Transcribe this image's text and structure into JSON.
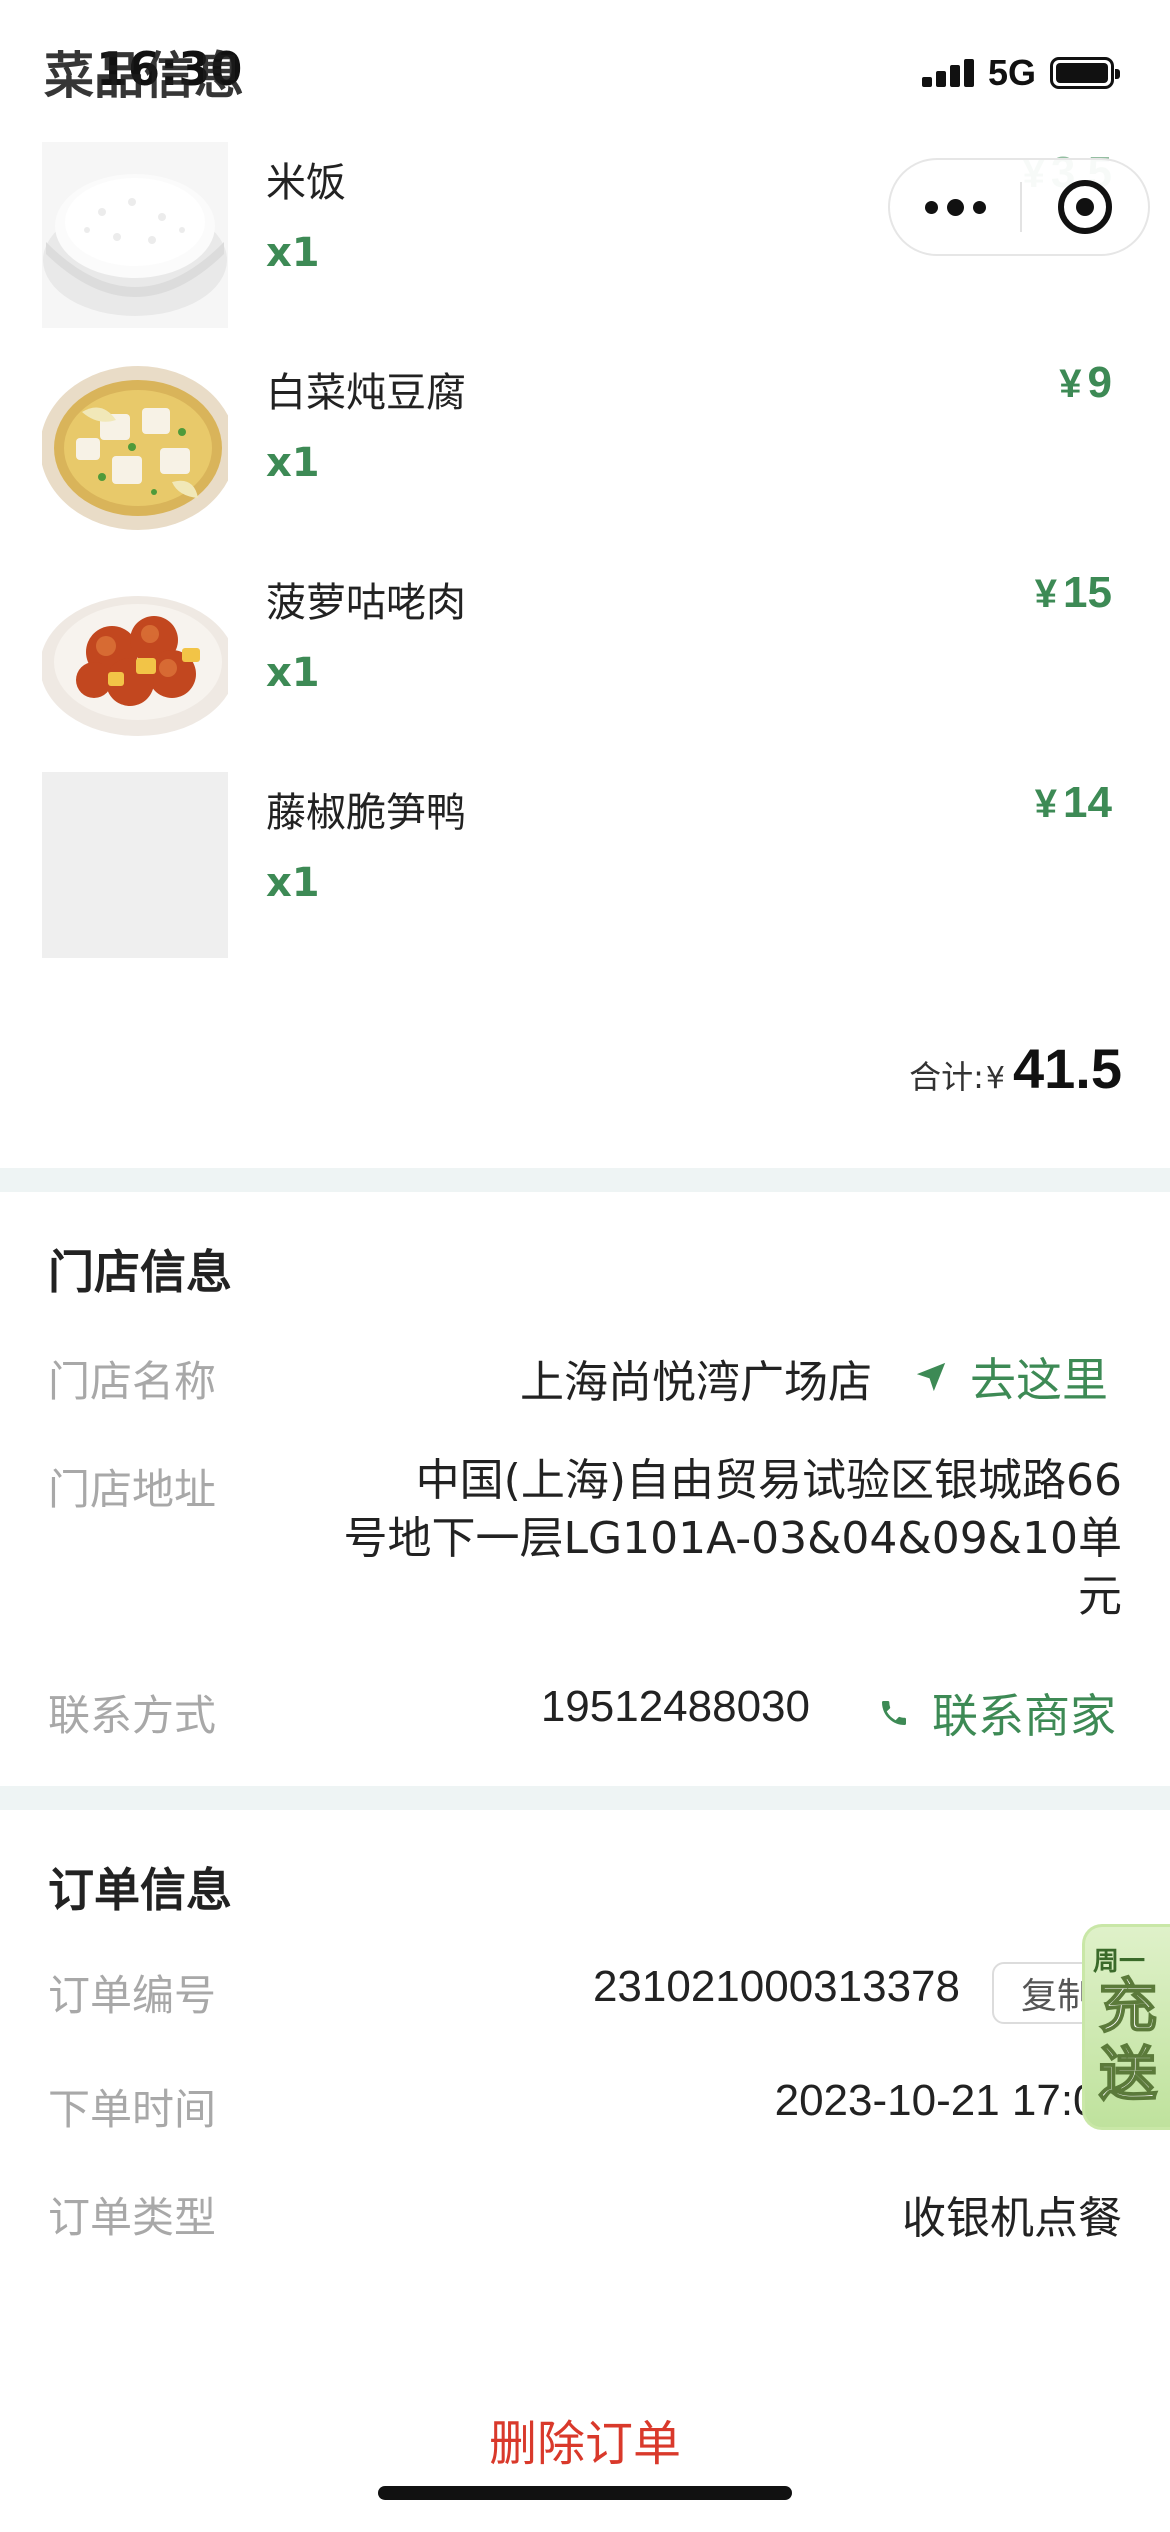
{
  "status_bar": {
    "time": "16:30",
    "network": "5G",
    "battery_percent": 100
  },
  "dishes_section": {
    "title": "菜品信息"
  },
  "dishes": [
    {
      "name": "米饭",
      "qty": "x1",
      "currency": "¥",
      "price": "3.5",
      "image": "rice-bowl"
    },
    {
      "name": "白菜炖豆腐",
      "qty": "x1",
      "currency": "¥",
      "price": "9",
      "image": "cabbage-tofu"
    },
    {
      "name": "菠萝咕咾肉",
      "qty": "x1",
      "currency": "¥",
      "price": "15",
      "image": "pineapple-pork"
    },
    {
      "name": "藤椒脆笋鸭",
      "qty": "x1",
      "currency": "¥",
      "price": "14",
      "image": "placeholder"
    }
  ],
  "total": {
    "label": "合计:",
    "currency": "¥",
    "value": "41.5"
  },
  "store": {
    "title": "门店信息",
    "name_label": "门店名称",
    "name_value": "上海尚悦湾广场店",
    "navigate_label": "去这里",
    "address_label": "门店地址",
    "address_line1": "中国(上海)自由贸易试验区银城路66",
    "address_line2": "号地下一层LG101A-03&04&09&10单",
    "address_line3": "元",
    "contact_label": "联系方式",
    "contact_value": "19512488030",
    "contact_action": "联系商家"
  },
  "order": {
    "title": "订单信息",
    "number_label": "订单编号",
    "number_value": "231021000313378",
    "copy_label": "复制",
    "time_label": "下单时间",
    "time_value": "2023-10-21 17:06",
    "type_label": "订单类型",
    "type_value": "收银机点餐"
  },
  "promo": {
    "line1": "周一",
    "char1": "充",
    "char2": "送"
  },
  "delete_label": "删除订单",
  "colors": {
    "accent_green": "#3d8a55",
    "delete_red": "#d9392b",
    "label_gray": "#a8a8a8",
    "divider": "#eef4f4"
  }
}
